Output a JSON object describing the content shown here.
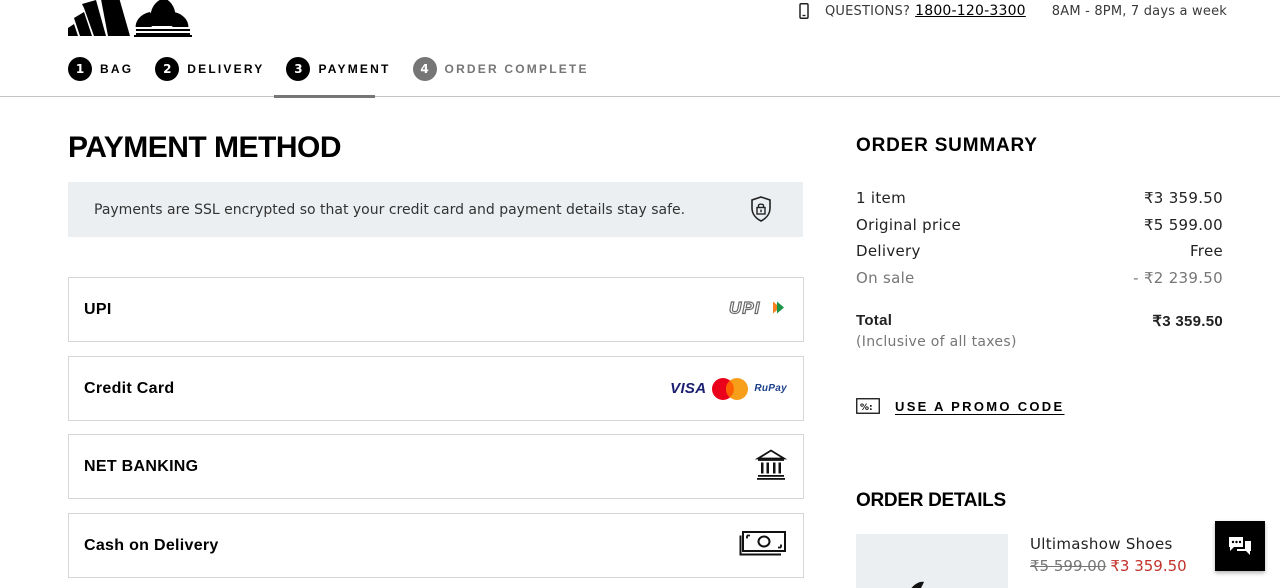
{
  "header": {
    "contact": {
      "questions_label": "QUESTIONS?",
      "phone": "1800-120-3300",
      "hours": "8AM - 8PM, 7 days a week"
    },
    "steps": [
      {
        "number": "1",
        "label": "BAG"
      },
      {
        "number": "2",
        "label": "DELIVERY"
      },
      {
        "number": "3",
        "label": "PAYMENT"
      },
      {
        "number": "4",
        "label": "ORDER COMPLETE"
      }
    ],
    "active_step": "PAYMENT"
  },
  "payment": {
    "title": "PAYMENT METHOD",
    "ssl_notice": "Payments are SSL encrypted so that your credit card and payment details stay safe.",
    "methods": [
      {
        "label": "UPI",
        "icon": "upi-logo"
      },
      {
        "label": "Credit Card",
        "icon": "card-brands"
      },
      {
        "label": "NET BANKING",
        "icon": "bank-icon"
      },
      {
        "label": "Cash on Delivery",
        "icon": "cash-icon"
      }
    ],
    "card_brands": {
      "visa": "VISA",
      "rupay": "RuPay"
    },
    "upi_text": "UPI"
  },
  "summary": {
    "title": "ORDER SUMMARY",
    "rows": [
      {
        "label": "1 item",
        "value": "₹3 359.50"
      },
      {
        "label": "Original price",
        "value": "₹5 599.00"
      },
      {
        "label": "Delivery",
        "value": "Free"
      },
      {
        "label": "On sale",
        "value": "- ₹2 239.50"
      }
    ],
    "total": {
      "label": "Total",
      "value": "₹3 359.50"
    },
    "tax_note": "(Inclusive of all taxes)",
    "promo_label": "USE A PROMO CODE",
    "promo_icon_text": "%:"
  },
  "details": {
    "title": "ORDER DETAILS",
    "product": {
      "name": "Ultimashow Shoes",
      "original_price": "₹5 599.00",
      "sale_price": "₹3 359.50"
    }
  },
  "colors": {
    "accent": "#000000",
    "muted": "#767677",
    "sale": "#c2322b",
    "notice_bg": "#eceff1"
  }
}
